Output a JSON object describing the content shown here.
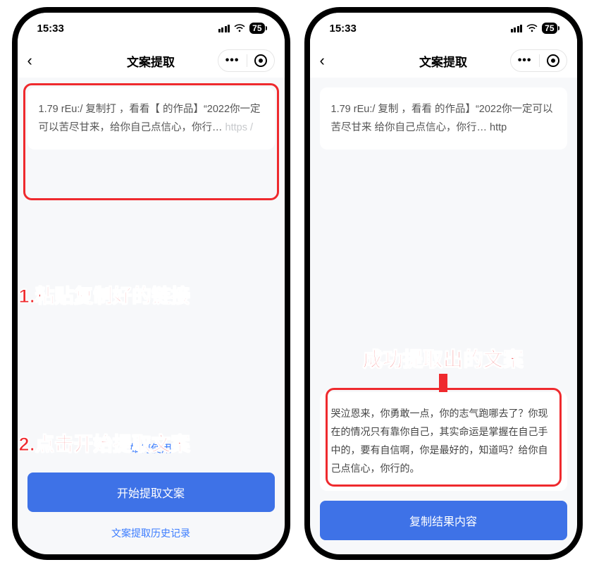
{
  "status": {
    "time": "15:33",
    "battery": "75"
  },
  "nav": {
    "title": "文案提取",
    "menu_dots": "•••"
  },
  "left": {
    "input_text_prefix": "1.79 rEu:/ 复制打",
    "input_text_mid1": "，看看【",
    "input_text_mid2": "的作品】“2022你一定可以苦尽甘来，给你自己点信心，你行… ",
    "input_text_faded": "https                                        /",
    "how_to": "如何使用",
    "start_btn": "开始提取文案",
    "history": "文案提取历史记录",
    "anno1": "1.粘贴复制好的链接",
    "anno2": "2.点击开始提取文案"
  },
  "right": {
    "input_text": "1.79 rEu:/ 复制            ，看看           的作品】“2022你一定可以苦尽甘来   给你自己点信心，你行… http                                      ",
    "anno": "成功提取出的文案",
    "result_text": "哭泣恩来，你勇敢一点，你的志气跑哪去了？你现在的情况只有靠你自己，其实命运是掌握在自己手中的，要有自信啊，你是最好的，知道吗？给你自己点信心，你行的。",
    "copy_btn": "复制结果内容"
  }
}
